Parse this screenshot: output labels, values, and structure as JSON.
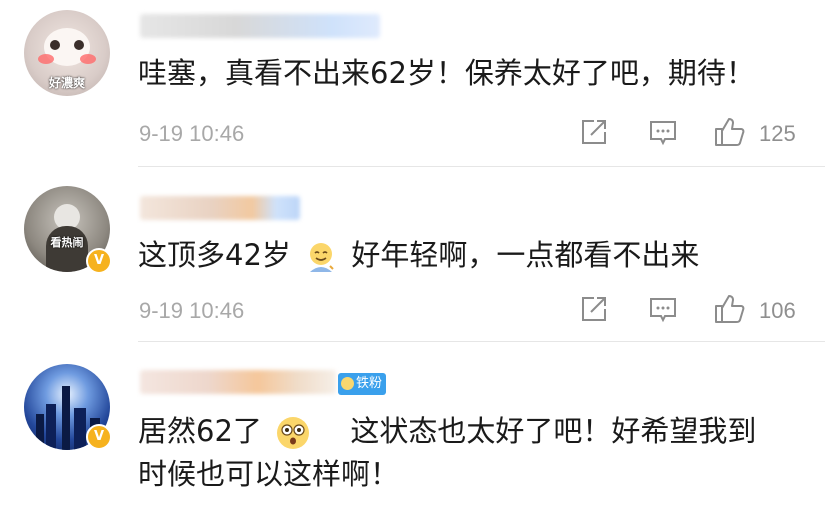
{
  "comments": [
    {
      "avatar_text": "好濃爽",
      "text": "哇塞，真看不出来62岁！保养太好了吧，期待！",
      "time": "9-19 10:46",
      "like_count": "125"
    },
    {
      "avatar_text": "看热闹",
      "text_before_emoji": "这顶多42岁",
      "emoji": "smirk-emoji",
      "text_after_emoji": "好年轻啊，一点都看不出来",
      "time": "9-19 10:46",
      "like_count": "106"
    },
    {
      "fan_badge": "铁粉",
      "text_line1_before_emoji": "居然62了",
      "emoji": "shocked-emoji",
      "text_line1_after_emoji": "这状态也太好了吧！好希望我到",
      "text_line2": "时候也可以这样啊！"
    }
  ],
  "icons": [
    "repost-icon",
    "comment-icon",
    "like-icon",
    "verified-v-icon"
  ],
  "colors": {
    "time_gray": "#a8a8a8",
    "verified_gold": "#f6b21e",
    "fan_badge_blue": "#3aa0ec"
  }
}
